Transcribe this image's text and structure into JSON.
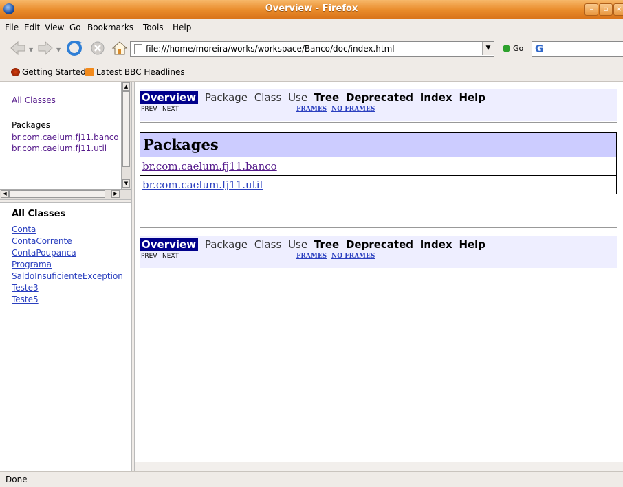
{
  "window": {
    "title": "Overview - Firefox"
  },
  "menu": [
    {
      "label": "File"
    },
    {
      "label": "Edit"
    },
    {
      "label": "View"
    },
    {
      "label": "Go"
    },
    {
      "label": "Bookmarks"
    },
    {
      "label": "Tools"
    },
    {
      "label": "Help"
    }
  ],
  "nav": {
    "url": "file:///home/moreira/works/workspace/Banco/doc/index.html",
    "go_label": "Go",
    "search_logo": "G"
  },
  "bookmarks": [
    {
      "label": "Getting Started",
      "icon": "firefox-icon"
    },
    {
      "label": "Latest BBC Headlines",
      "icon": "rss-icon"
    }
  ],
  "left_top": {
    "all_classes": "All Classes",
    "packages_heading": "Packages",
    "packages": [
      "br.com.caelum.fj11.banco",
      "br.com.caelum.fj11.util"
    ]
  },
  "left_bottom": {
    "heading": "All Classes",
    "classes": [
      "Conta",
      "ContaCorrente",
      "ContaPoupanca",
      "Programa",
      "SaldoInsuficienteException",
      "Teste3",
      "Teste5"
    ]
  },
  "main": {
    "navbar": {
      "overview": "Overview",
      "package": "Package",
      "class": "Class",
      "use": "Use",
      "tree": "Tree",
      "deprecated": "Deprecated",
      "index": "Index",
      "help": "Help",
      "prev": "PREV",
      "next": "NEXT",
      "frames": "FRAMES",
      "no_frames": "NO FRAMES"
    },
    "table_heading": "Packages",
    "packages": [
      "br.com.caelum.fj11.banco",
      "br.com.caelum.fj11.util"
    ]
  },
  "status": "Done",
  "colors": {
    "titlebar": "#e98b2a",
    "nav_current": "#00008b",
    "nav_bg": "#eeeeff",
    "table_header": "#ccccff"
  }
}
